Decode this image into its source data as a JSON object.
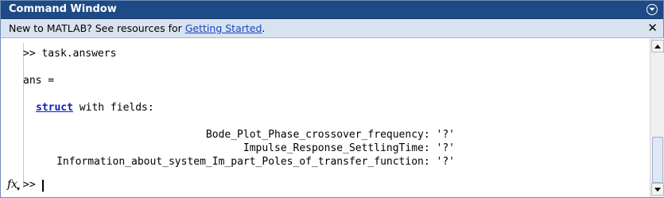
{
  "window": {
    "title": "Command Window"
  },
  "banner": {
    "text_before": "New to MATLAB? See resources for ",
    "link_text": "Getting Started",
    "text_after": ".",
    "close_glyph": "✕"
  },
  "console": {
    "lines": {
      "command": ">> task.answers",
      "ans": "ans =",
      "struct_kw": "struct",
      "struct_rest": " with fields:",
      "field1": "Bode_Plot_Phase_crossover_frequency: '?'",
      "field2": "Impulse_Response_SettlingTime: '?'",
      "field3": "Information_about_system_Im_part_Poles_of_transfer_function: '?'"
    },
    "prompt": ">>",
    "fx_label": "fx"
  },
  "colors": {
    "titlebar": "#1e4a86",
    "banner_bg": "#d9e3ef",
    "link": "#1a44c8",
    "keyword": "#0a1fbf"
  },
  "icons": {
    "title_menu": "chevron-down-circle-icon",
    "banner_close": "close-icon",
    "fx": "function-browser-icon",
    "scroll_up": "arrow-up-icon",
    "scroll_down": "arrow-down-icon"
  }
}
